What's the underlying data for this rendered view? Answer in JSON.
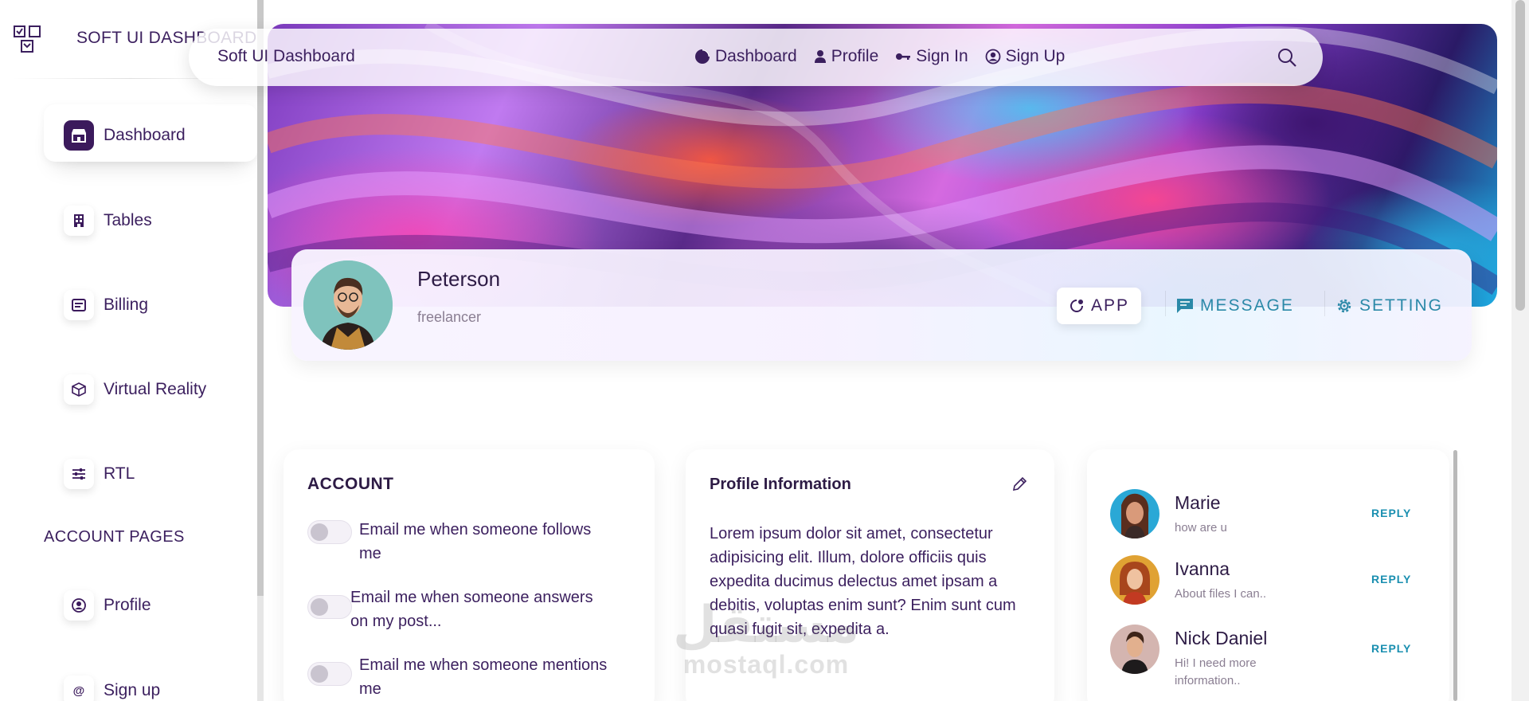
{
  "sidebar": {
    "brand": "SOFT UI DASHBOARD",
    "items": [
      {
        "label": "Dashboard",
        "icon": "shop-icon",
        "active": true
      },
      {
        "label": "Tables",
        "icon": "building-icon"
      },
      {
        "label": "Billing",
        "icon": "billing-icon"
      },
      {
        "label": "Virtual Reality",
        "icon": "cube-icon"
      },
      {
        "label": "RTL",
        "icon": "sliders-icon"
      }
    ],
    "section_title": "ACCOUNT PAGES",
    "account_items": [
      {
        "label": "Profile",
        "icon": "user-circle-icon"
      },
      {
        "label": "Sign up",
        "icon": "at-icon"
      }
    ]
  },
  "navbar": {
    "brand": "Soft UI Dashboard",
    "links": [
      {
        "label": "Dashboard",
        "icon": "pie-chart-icon"
      },
      {
        "label": "Profile",
        "icon": "user-icon"
      },
      {
        "label": "Sign In",
        "icon": "key-icon"
      },
      {
        "label": "Sign Up",
        "icon": "user-circle-icon"
      }
    ],
    "search_icon": "search-icon"
  },
  "profile": {
    "name": "Peterson",
    "role": "freelancer",
    "tabs": [
      {
        "label": "APP",
        "icon": "app-icon",
        "active": true
      },
      {
        "label": "MESSAGE",
        "icon": "message-icon"
      },
      {
        "label": "SETTING",
        "icon": "gear-icon"
      }
    ]
  },
  "account": {
    "title": "ACCOUNT",
    "toggles": [
      {
        "label": "Email me when someone follows me",
        "checked": false
      },
      {
        "label": "Email me when someone answers on my post...",
        "checked": false
      },
      {
        "label": "Email me when someone mentions me",
        "checked": false
      }
    ]
  },
  "info": {
    "title": "Profile Information",
    "text": "Lorem ipsum dolor sit amet, consectetur adipisicing elit. Illum, dolore officiis quis expedita ducimus delectus amet ipsam a debitis, voluptas enim sunt? Enim sunt cum quasi fugit sit, expedita a."
  },
  "conversations": [
    {
      "name": "Marie",
      "message": "how are u",
      "action": "REPLY"
    },
    {
      "name": "Ivanna",
      "message": "About files I can..",
      "action": "REPLY"
    },
    {
      "name": "Nick Daniel",
      "message": "Hi! I need more information..",
      "action": "REPLY"
    }
  ],
  "watermark": {
    "arabic": "مستقل",
    "latin": "mostaql.com"
  },
  "colors": {
    "primary": "#3b1a5c",
    "accent": "#1a8fb0",
    "text": "#3b1f5e",
    "muted": "#8a7e92"
  }
}
